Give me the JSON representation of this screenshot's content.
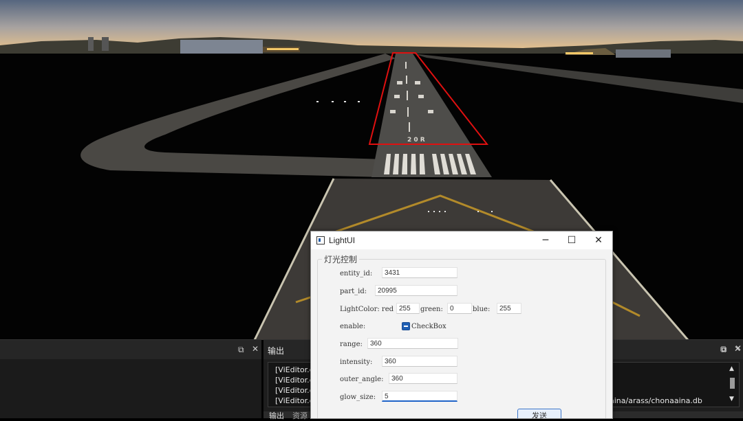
{
  "window": {
    "title": "LightUI",
    "minimize_glyph": "─",
    "maximize_glyph": "☐",
    "close_glyph": "✕"
  },
  "group": {
    "title": "灯光控制"
  },
  "form": {
    "entity_id_label": "entity_id:",
    "entity_id_value": "3431",
    "part_id_label": "part_id:",
    "part_id_value": "20995",
    "lightcolor_label": "LightColor: red",
    "red_value": "255",
    "green_label": "green:",
    "green_value": "0",
    "blue_label": "blue:",
    "blue_value": "255",
    "enable_label": "enable:",
    "checkbox_label": "CheckBox",
    "enable_checked": true,
    "range_label": "range:",
    "range_value": "360",
    "intensity_label": "intensity:",
    "intensity_value": "360",
    "outer_angle_label": "outer_angle:",
    "outer_angle_value": "360",
    "glow_size_label": "glow_size:",
    "glow_size_value": "5",
    "send_button": "发送"
  },
  "output_panel": {
    "title": "输出",
    "restore_glyph": "⧉",
    "close_glyph": "✕",
    "lines": [
      "[ViEditor.e",
      "[ViEditor.e",
      "[ViEditor.e",
      "[ViEditor.e"
    ],
    "path_fragment": "aina/arass/chonaaina.db",
    "tabs": [
      "输出",
      "资源"
    ]
  },
  "left_panel": {
    "restore_glyph": "⧉",
    "close_glyph": "✕"
  },
  "right_panel": {
    "restore_glyph": "⧉",
    "close_glyph": "✕",
    "scroll_up": "▲",
    "scroll_down": "▼"
  },
  "scene": {
    "runway_number": "2 0 R",
    "highlight_color": "#e01010",
    "sky_top": "#5d6f88",
    "sky_horizon": "#e9c48a"
  }
}
